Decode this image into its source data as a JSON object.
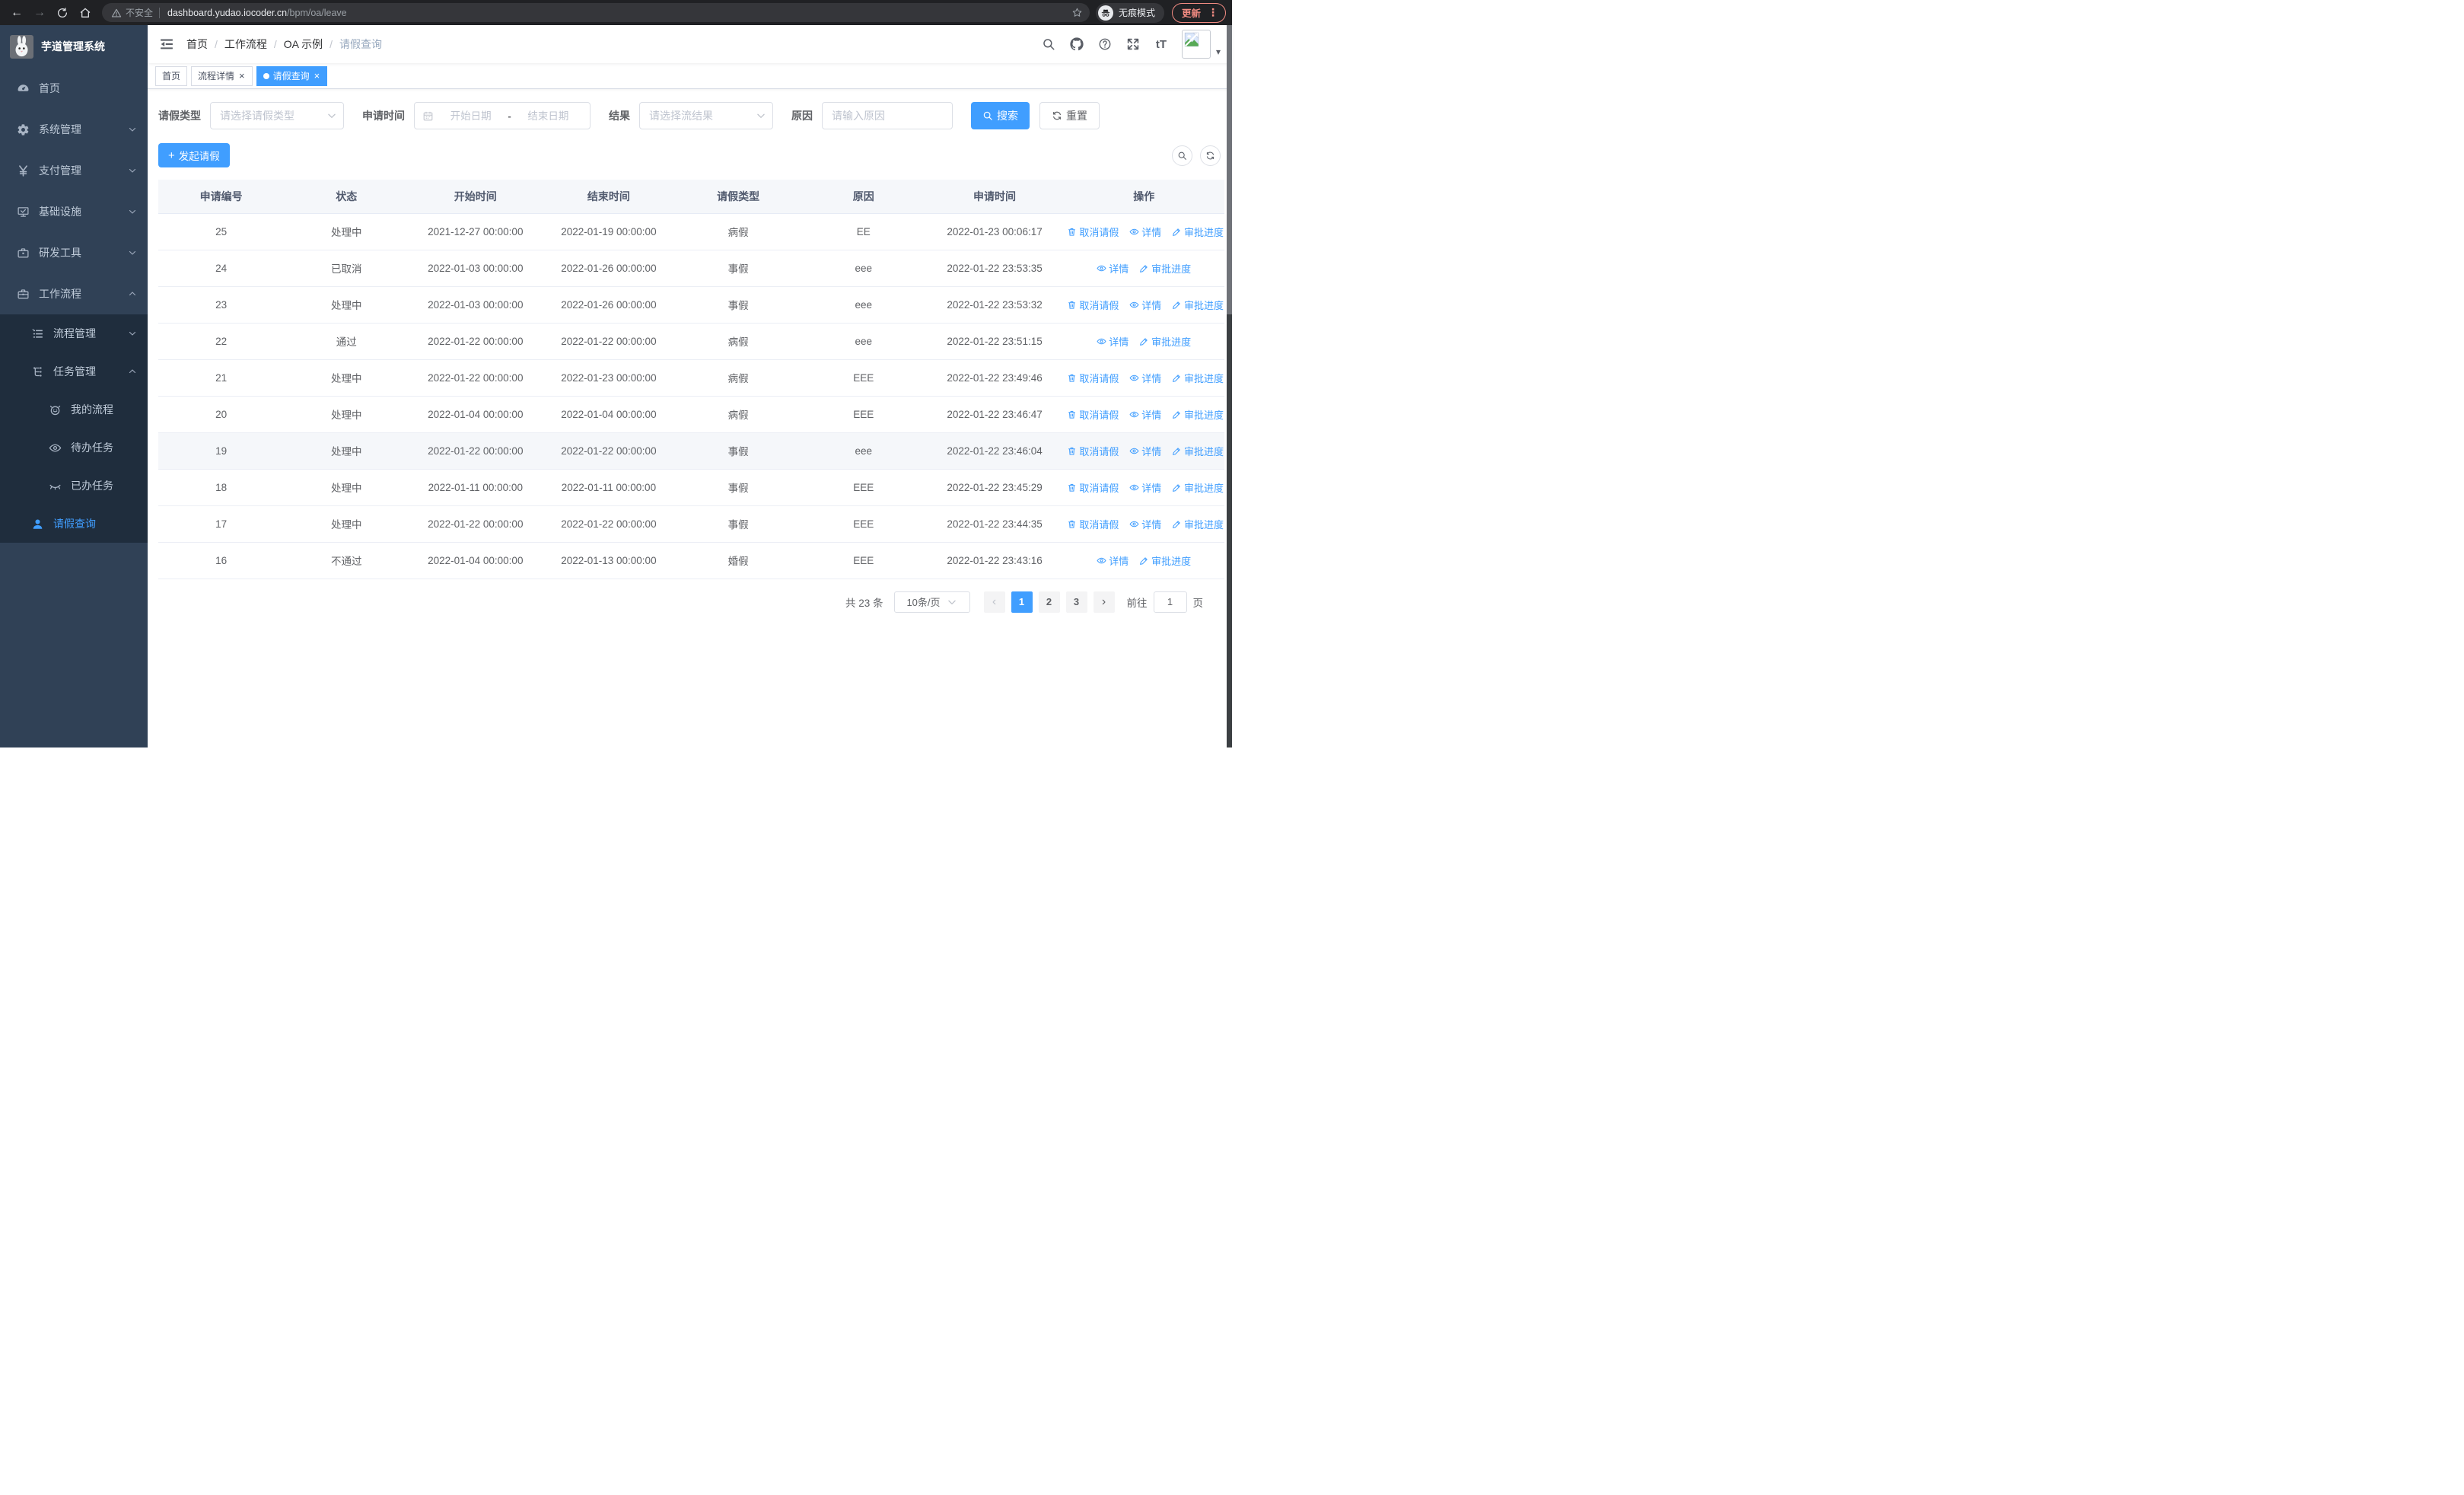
{
  "colors": {
    "primary": "#409eff",
    "sidebar_bg": "#304156",
    "submenu_bg": "#1f2d3d",
    "update_accent": "#f28b82"
  },
  "icons": {
    "close": "×",
    "back": "←",
    "forward": "→",
    "more": "⋮",
    "caret_down": "▾",
    "font_size": "tT",
    "plus": "+",
    "prev": "‹",
    "next": "›"
  },
  "browser": {
    "security_label": "不安全",
    "url_host": "dashboard.yudao.iocoder.cn",
    "url_path": "/bpm/oa/leave",
    "incognito_label": "无痕模式",
    "update_label": "更新"
  },
  "sidebar": {
    "app_title": "芋道管理系统",
    "items": [
      {
        "label": "首页",
        "icon": "dashboard-icon"
      },
      {
        "label": "系统管理",
        "icon": "gear-icon",
        "expandable": true
      },
      {
        "label": "支付管理",
        "icon": "yen-icon",
        "expandable": true
      },
      {
        "label": "基础设施",
        "icon": "monitor-icon",
        "expandable": true
      },
      {
        "label": "研发工具",
        "icon": "toolbox-icon",
        "expandable": true
      },
      {
        "label": "工作流程",
        "icon": "briefcase-icon",
        "expandable": true,
        "expanded": true
      }
    ],
    "workflow_children": [
      {
        "label": "流程管理",
        "icon": "list-icon",
        "expandable": true
      },
      {
        "label": "任务管理",
        "icon": "tree-icon",
        "expandable": true,
        "expanded": true
      }
    ],
    "task_children": [
      {
        "label": "我的流程",
        "icon": "face-icon"
      },
      {
        "label": "待办任务",
        "icon": "eye-open-icon"
      },
      {
        "label": "已办任务",
        "icon": "eye-closed-icon"
      }
    ],
    "workflow_children_bottom": [
      {
        "label": "请假查询",
        "icon": "user-icon",
        "active": true
      }
    ]
  },
  "header": {
    "separator": "/",
    "breadcrumbs": [
      {
        "label": "首页"
      },
      {
        "label": "工作流程",
        "sep": true
      },
      {
        "label": "OA 示例",
        "sep": true
      },
      {
        "label": "请假查询",
        "sep": true,
        "current": true
      }
    ]
  },
  "tabs": [
    {
      "label": "首页"
    },
    {
      "label": "流程详情",
      "closable": true
    },
    {
      "label": "请假查询",
      "closable": true,
      "active": true
    }
  ],
  "filters": {
    "leave_type_label": "请假类型",
    "leave_type_placeholder": "请选择请假类型",
    "apply_time_label": "申请时间",
    "start_date_placeholder": "开始日期",
    "date_separator": "-",
    "end_date_placeholder": "结束日期",
    "result_label": "结果",
    "result_placeholder": "请选择流结果",
    "reason_label": "原因",
    "reason_placeholder": "请输入原因",
    "search_label": "搜索",
    "reset_label": "重置"
  },
  "toolbar": {
    "create_label": "发起请假"
  },
  "table": {
    "columns": [
      {
        "label": "申请编号"
      },
      {
        "label": "状态"
      },
      {
        "label": "开始时间"
      },
      {
        "label": "结束时间"
      },
      {
        "label": "请假类型"
      },
      {
        "label": "原因"
      },
      {
        "label": "申请时间"
      },
      {
        "label": "操作"
      }
    ],
    "action_labels": {
      "cancel": "取消请假",
      "detail": "详情",
      "progress": "审批进度"
    },
    "rows": [
      {
        "id": "25",
        "status": "处理中",
        "start": "2021-12-27 00:00:00",
        "end": "2022-01-19 00:00:00",
        "type": "病假",
        "reason": "EE",
        "applied": "2022-01-23 00:06:17",
        "can_cancel": true
      },
      {
        "id": "24",
        "status": "已取消",
        "start": "2022-01-03 00:00:00",
        "end": "2022-01-26 00:00:00",
        "type": "事假",
        "reason": "eee",
        "applied": "2022-01-22 23:53:35"
      },
      {
        "id": "23",
        "status": "处理中",
        "start": "2022-01-03 00:00:00",
        "end": "2022-01-26 00:00:00",
        "type": "事假",
        "reason": "eee",
        "applied": "2022-01-22 23:53:32",
        "can_cancel": true
      },
      {
        "id": "22",
        "status": "通过",
        "start": "2022-01-22 00:00:00",
        "end": "2022-01-22 00:00:00",
        "type": "病假",
        "reason": "eee",
        "applied": "2022-01-22 23:51:15"
      },
      {
        "id": "21",
        "status": "处理中",
        "start": "2022-01-22 00:00:00",
        "end": "2022-01-23 00:00:00",
        "type": "病假",
        "reason": "EEE",
        "applied": "2022-01-22 23:49:46",
        "can_cancel": true
      },
      {
        "id": "20",
        "status": "处理中",
        "start": "2022-01-04 00:00:00",
        "end": "2022-01-04 00:00:00",
        "type": "病假",
        "reason": "EEE",
        "applied": "2022-01-22 23:46:47",
        "can_cancel": true
      },
      {
        "id": "19",
        "status": "处理中",
        "start": "2022-01-22 00:00:00",
        "end": "2022-01-22 00:00:00",
        "type": "事假",
        "reason": "eee",
        "applied": "2022-01-22 23:46:04",
        "can_cancel": true,
        "highlight": true
      },
      {
        "id": "18",
        "status": "处理中",
        "start": "2022-01-11 00:00:00",
        "end": "2022-01-11 00:00:00",
        "type": "事假",
        "reason": "EEE",
        "applied": "2022-01-22 23:45:29",
        "can_cancel": true
      },
      {
        "id": "17",
        "status": "处理中",
        "start": "2022-01-22 00:00:00",
        "end": "2022-01-22 00:00:00",
        "type": "事假",
        "reason": "EEE",
        "applied": "2022-01-22 23:44:35",
        "can_cancel": true
      },
      {
        "id": "16",
        "status": "不通过",
        "start": "2022-01-04 00:00:00",
        "end": "2022-01-13 00:00:00",
        "type": "婚假",
        "reason": "EEE",
        "applied": "2022-01-22 23:43:16"
      }
    ]
  },
  "pagination": {
    "total_label": "共 23 条",
    "page_size_value": "10条/页",
    "pages": [
      {
        "n": "1",
        "active": true
      },
      {
        "n": "2"
      },
      {
        "n": "3"
      }
    ],
    "goto_label": "前往",
    "goto_value": "1",
    "page_unit": "页"
  }
}
